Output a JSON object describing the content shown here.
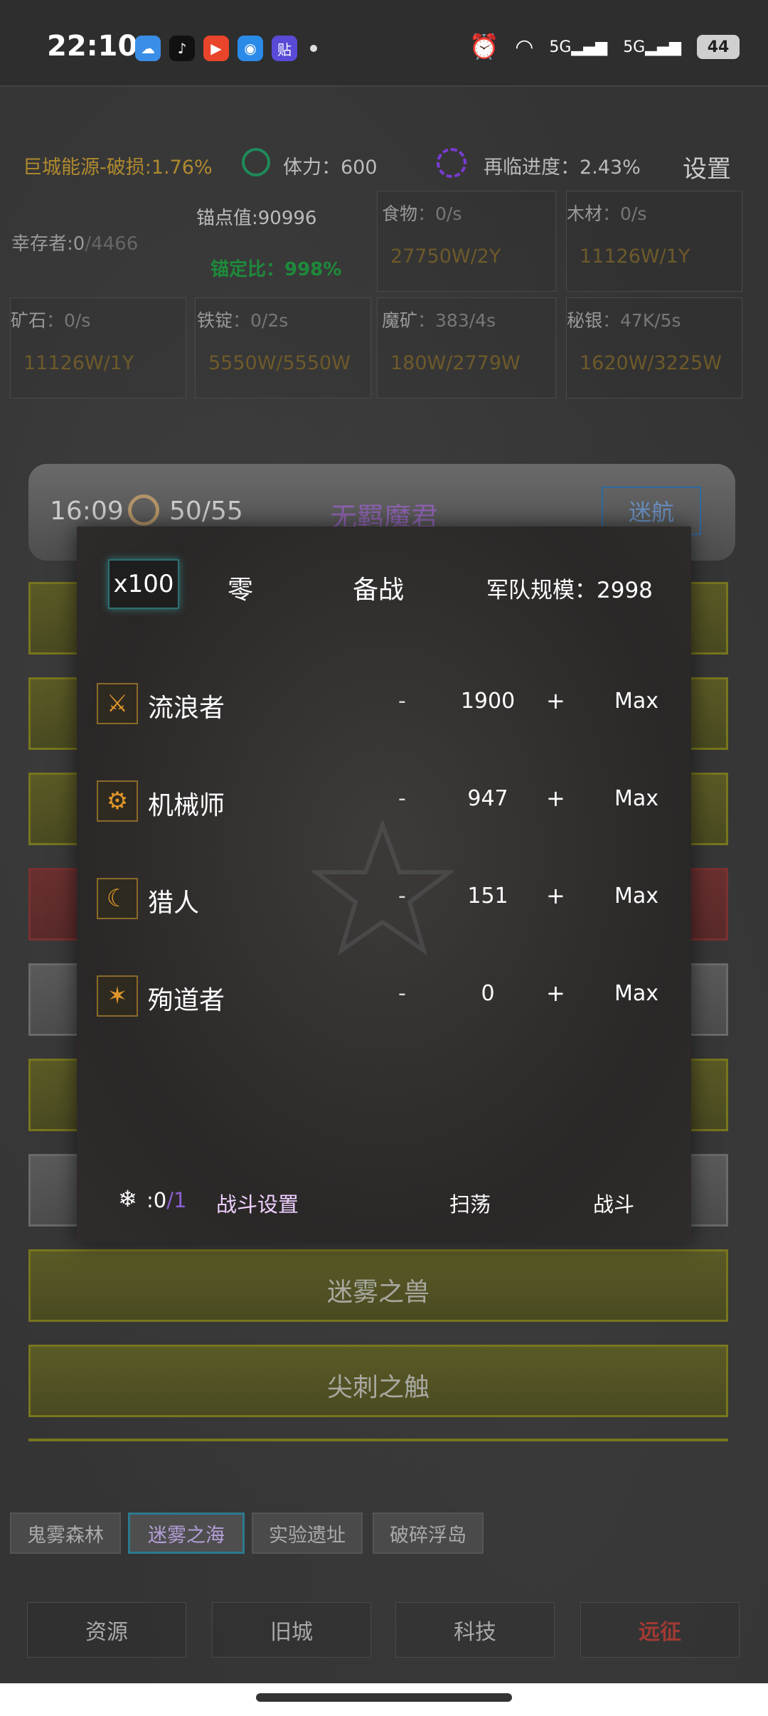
{
  "status_bar": {
    "time": "22:10",
    "battery": "44",
    "signal1": "5G",
    "signal2": "5G"
  },
  "resources": {
    "energy": "巨城能源-破损:1.76%",
    "stamina": "体力：600",
    "progress": "再临进度：2.43%",
    "settings": "设置",
    "survivor_label": "幸存者:0",
    "survivor_max": "/4466",
    "anchor_value": "锚点值:90996",
    "anchor_ratio": "锚定比：998%",
    "cells": [
      {
        "label": "食物",
        "rate": "：0/s",
        "value": "27750W/2Y"
      },
      {
        "label": "木材",
        "rate": "：0/s",
        "value": "11126W/1Y"
      },
      {
        "label": "矿石",
        "rate": "：0/s",
        "value": "11126W/1Y"
      },
      {
        "label": "铁锭",
        "rate": "：0/2s",
        "value": "5550W/5550W"
      },
      {
        "label": "魔矿",
        "rate": "：383/4s",
        "value": "180W/2779W"
      },
      {
        "label": "秘银",
        "rate": "：47K/5s",
        "value": "1620W/3225W"
      }
    ]
  },
  "expedition": {
    "time": "16:09",
    "count": "50/55",
    "boss": "无羁魔君",
    "nav_button": "迷航"
  },
  "stages": {
    "mist_beast": "迷雾之兽",
    "spike_touch": "尖刺之触"
  },
  "modal": {
    "multiplier": "x100",
    "zero": "零",
    "prepare": "备战",
    "army_size": "军队规模：2998",
    "units": [
      {
        "name": "流浪者",
        "count": "1900",
        "icon": "wanderer-icon",
        "glyph": "⚔"
      },
      {
        "name": "机械师",
        "count": "947",
        "icon": "mechanic-icon",
        "glyph": "⚙"
      },
      {
        "name": "猎人",
        "count": "151",
        "icon": "hunter-icon",
        "glyph": "☾"
      },
      {
        "name": "殉道者",
        "count": "0",
        "icon": "martyr-icon",
        "glyph": "✶"
      }
    ],
    "minus": "-",
    "plus": "+",
    "max": "Max",
    "snow_count": ":0",
    "snow_total": "/1",
    "battle_settings": "战斗设置",
    "sweep": "扫荡",
    "fight": "战斗"
  },
  "map_tabs": [
    "鬼雾森林",
    "迷雾之海",
    "实验遗址",
    "破碎浮岛"
  ],
  "bottom_nav": [
    "资源",
    "旧城",
    "科技",
    "远征"
  ]
}
